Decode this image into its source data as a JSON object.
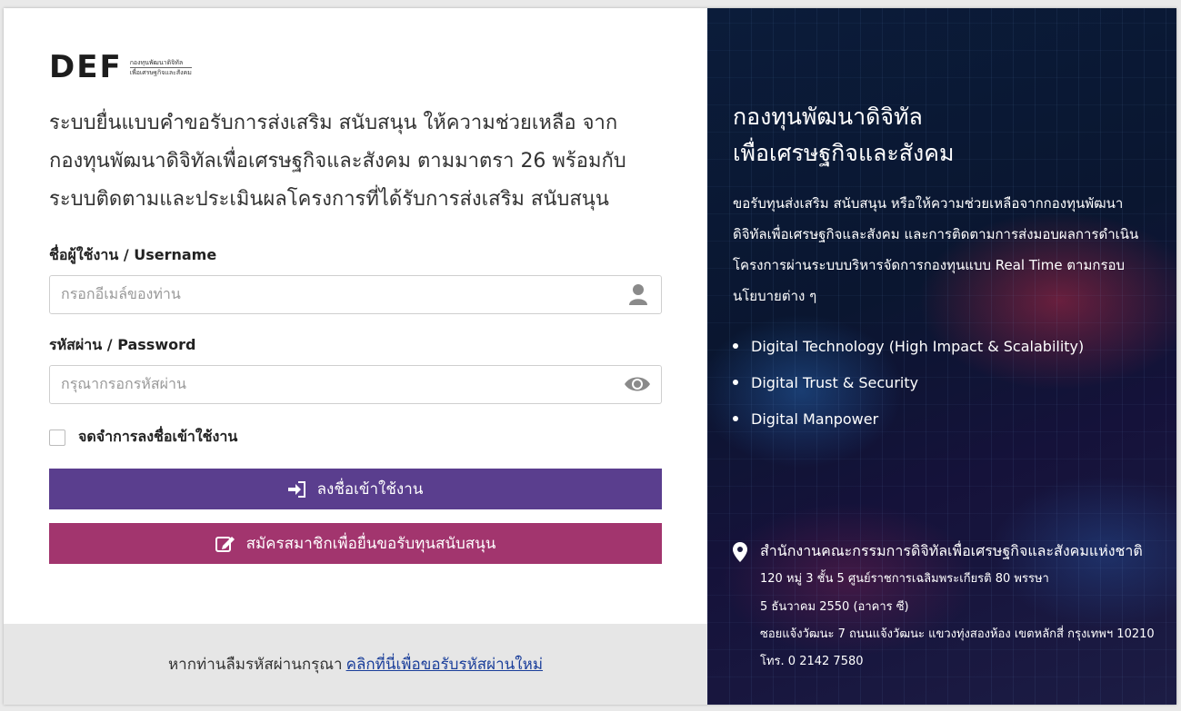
{
  "logo": {
    "mark": "DEF",
    "sub_line1": "กองทุนพัฒนาดิจิทัล",
    "sub_line2": "เพื่อเศรษฐกิจและสังคม"
  },
  "headline": {
    "line1": "ระบบยื่นแบบคำขอรับการส่งเสริม สนับสนุน ให้ความช่วยเหลือ จาก",
    "line2": "กองทุนพัฒนาดิจิทัลเพื่อเศรษฐกิจและสังคม ตามมาตรา 26 พร้อมกับ",
    "line3": "ระบบติดตามและประเมินผลโครงการที่ได้รับการส่งเสริม สนับสนุน"
  },
  "form": {
    "username_label": "ชื่อผู้ใช้งาน / Username",
    "username_placeholder": "กรอกอีเมล์ของท่าน",
    "username_value": "",
    "password_label": "รหัสผ่าน / Password",
    "password_placeholder": "กรุณากรอกรหัสผ่าน",
    "password_value": "",
    "remember_label": "จดจำการลงชื่อเข้าใช้งาน",
    "remember_checked": false,
    "login_button": "ลงชื่อเข้าใช้งาน",
    "register_button": "สมัครสมาชิกเพื่อยื่นขอรับทุนสนับสนุน"
  },
  "forgot": {
    "text": "หากท่านลืมรหัสผ่านกรุณา",
    "link": "คลิกที่นี่เพื่อขอรับรหัสผ่านใหม่"
  },
  "right": {
    "title_line1": "กองทุนพัฒนาดิจิทัล",
    "title_line2": "เพื่อเศรษฐกิจและสังคม",
    "desc_line1": "ขอรับทุนส่งเสริม สนับสนุน หรือให้ความช่วยเหลือจากกองทุนพัฒนา",
    "desc_line2": "ดิจิทัลเพื่อเศรษฐกิจและสังคม และการติดตามการส่งมอบผลการดำเนิน",
    "desc_line3": "โครงการผ่านระบบบริหารจัดการกองทุนแบบ Real Time ตามกรอบ",
    "desc_line4": "นโยบายต่าง ๆ",
    "bullets": [
      "Digital Technology (High Impact & Scalability)",
      "Digital Trust & Security",
      "Digital Manpower"
    ],
    "address": {
      "title": "สำนักงานคณะกรรมการดิจิทัลเพื่อเศรษฐกิจและสังคมแห่งชาติ",
      "line1": "120 หมู่ 3 ชั้น 5 ศูนย์ราชการเฉลิมพระเกียรติ 80 พรรษา",
      "line2": "5 ธันวาคม 2550 (อาคาร ซี)",
      "line3": "ซอยแจ้งวัฒนะ 7 ถนนแจ้งวัฒนะ แขวงทุ่งสองห้อง เขตหลักสี่ กรุงเทพฯ 10210",
      "line4": "โทร. 0 2142 7580"
    }
  },
  "colors": {
    "login_button": "#5a3e8e",
    "register_button": "#a2356e",
    "logo_accent": "#5cb531",
    "link": "#1a3e9a"
  }
}
